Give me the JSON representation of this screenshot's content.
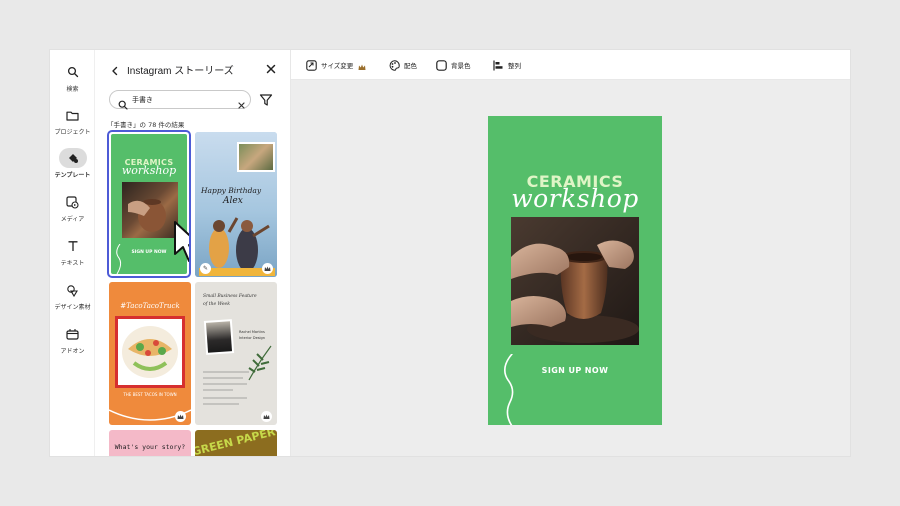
{
  "rail": {
    "items": [
      {
        "label": "検索",
        "icon": "search-icon"
      },
      {
        "label": "プロジェクト",
        "icon": "folder-icon"
      },
      {
        "label": "テンプレート",
        "icon": "templates-icon"
      },
      {
        "label": "メディア",
        "icon": "media-icon"
      },
      {
        "label": "テキスト",
        "icon": "text-icon"
      },
      {
        "label": "デザイン素材",
        "icon": "shapes-icon"
      },
      {
        "label": "アドオン",
        "icon": "addons-icon"
      }
    ]
  },
  "panel": {
    "title": "Instagram ストーリーズ",
    "search_value": "手書き",
    "result_count": "「手書き」の 78 件の結果"
  },
  "templates": [
    {
      "name": "ceramics-workshop",
      "heading": "CERAMICS",
      "script": "workshop",
      "cta": "SIGN UP NOW",
      "bg": "#55be6a",
      "selected": true
    },
    {
      "name": "happy-birthday",
      "script_line1": "Happy Birthday",
      "script_line2": "Alex",
      "bg": "#b9d3e6",
      "premium": true
    },
    {
      "name": "taco-truck",
      "hashtag": "#TacoTacoTruck",
      "caption": "THE BEST TACOS IN TOWN",
      "bg": "#ef8a3c",
      "premium": true
    },
    {
      "name": "small-business",
      "title_line1": "Small Business Feature",
      "title_line2": "of the Week",
      "person": "Rachel Martins",
      "role": "Interior Design",
      "bg": "#e4e2dd",
      "premium": true
    },
    {
      "name": "whats-your-story",
      "text": "What's your story?",
      "bg": "#f4b9c8"
    },
    {
      "name": "green-paper",
      "text": "GREEN PAPER",
      "bg": "#8c6d1f"
    }
  ],
  "toolbar": {
    "items": [
      {
        "label": "サイズ変更",
        "icon": "resize-icon",
        "premium": true
      },
      {
        "label": "配色",
        "icon": "palette-icon"
      },
      {
        "label": "背景色",
        "icon": "background-color-icon"
      },
      {
        "label": "整列",
        "icon": "align-icon"
      }
    ]
  },
  "canvas": {
    "heading": "CERAMICS",
    "script": "workshop",
    "cta": "SIGN UP NOW",
    "bg": "#55be6a",
    "heading_color": "#dff5c6"
  },
  "colors": {
    "selection": "#4d5bd6",
    "premium": "#9a6f2d"
  }
}
